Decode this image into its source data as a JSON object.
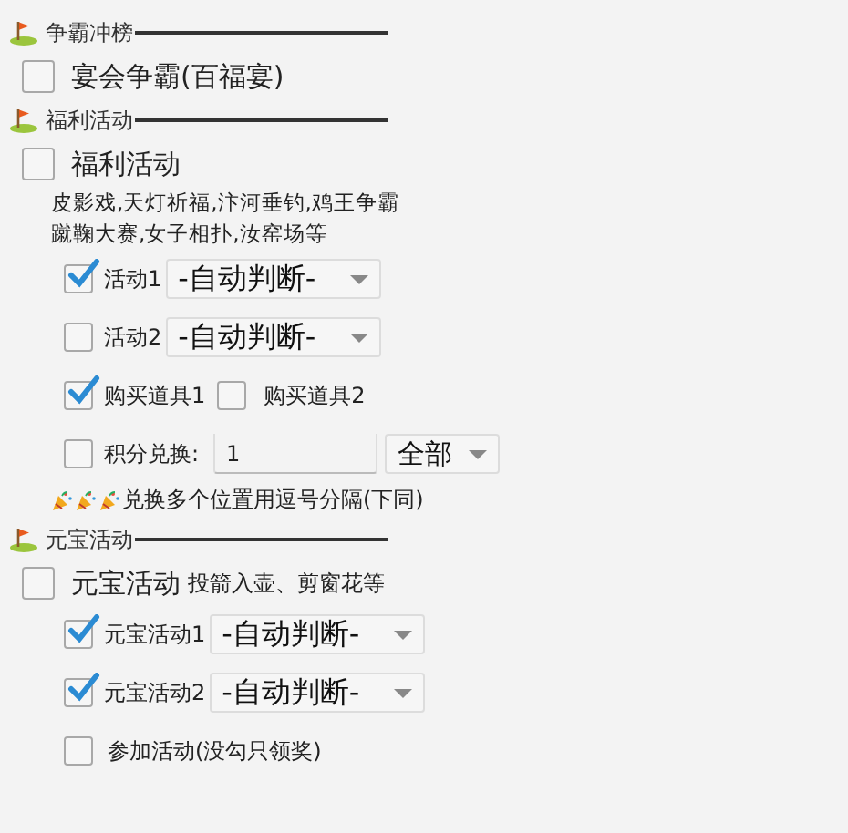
{
  "sections": [
    {
      "title": "争霸冲榜",
      "rows": [
        {
          "kind": "check",
          "label": "宴会争霸(百福宴)",
          "checked": false
        }
      ]
    },
    {
      "title": "福利活动",
      "rows": [
        {
          "kind": "check",
          "label": "福利活动",
          "checked": false
        },
        {
          "kind": "note",
          "lines": [
            "皮影戏,天灯祈福,汴河垂钓,鸡王争霸",
            "蹴鞠大赛,女子相扑,汝窑场等"
          ]
        },
        {
          "kind": "select",
          "label": "活动1",
          "checked": true,
          "value": "-自动判断-"
        },
        {
          "kind": "select",
          "label": "活动2",
          "checked": false,
          "value": "-自动判断-"
        },
        {
          "kind": "pair",
          "items": [
            {
              "label": "购买道具1",
              "checked": true
            },
            {
              "label": "购买道具2",
              "checked": false
            }
          ]
        },
        {
          "kind": "input",
          "label": "积分兑换:",
          "checked": false,
          "value": "1",
          "option": "全部"
        },
        {
          "kind": "hint",
          "text": "兑换多个位置用逗号分隔(下同)"
        }
      ]
    },
    {
      "title": "元宝活动",
      "rows": [
        {
          "kind": "check",
          "label": "元宝活动",
          "checked": false,
          "note": "投箭入壶、剪窗花等"
        },
        {
          "kind": "select",
          "label": "元宝活动1",
          "checked": true,
          "value": "-自动判断-"
        },
        {
          "kind": "select",
          "label": "元宝活动2",
          "checked": true,
          "value": "-自动判断-"
        },
        {
          "kind": "subcheck",
          "label": "参加活动(没勾只领奖)",
          "checked": false
        }
      ]
    }
  ]
}
